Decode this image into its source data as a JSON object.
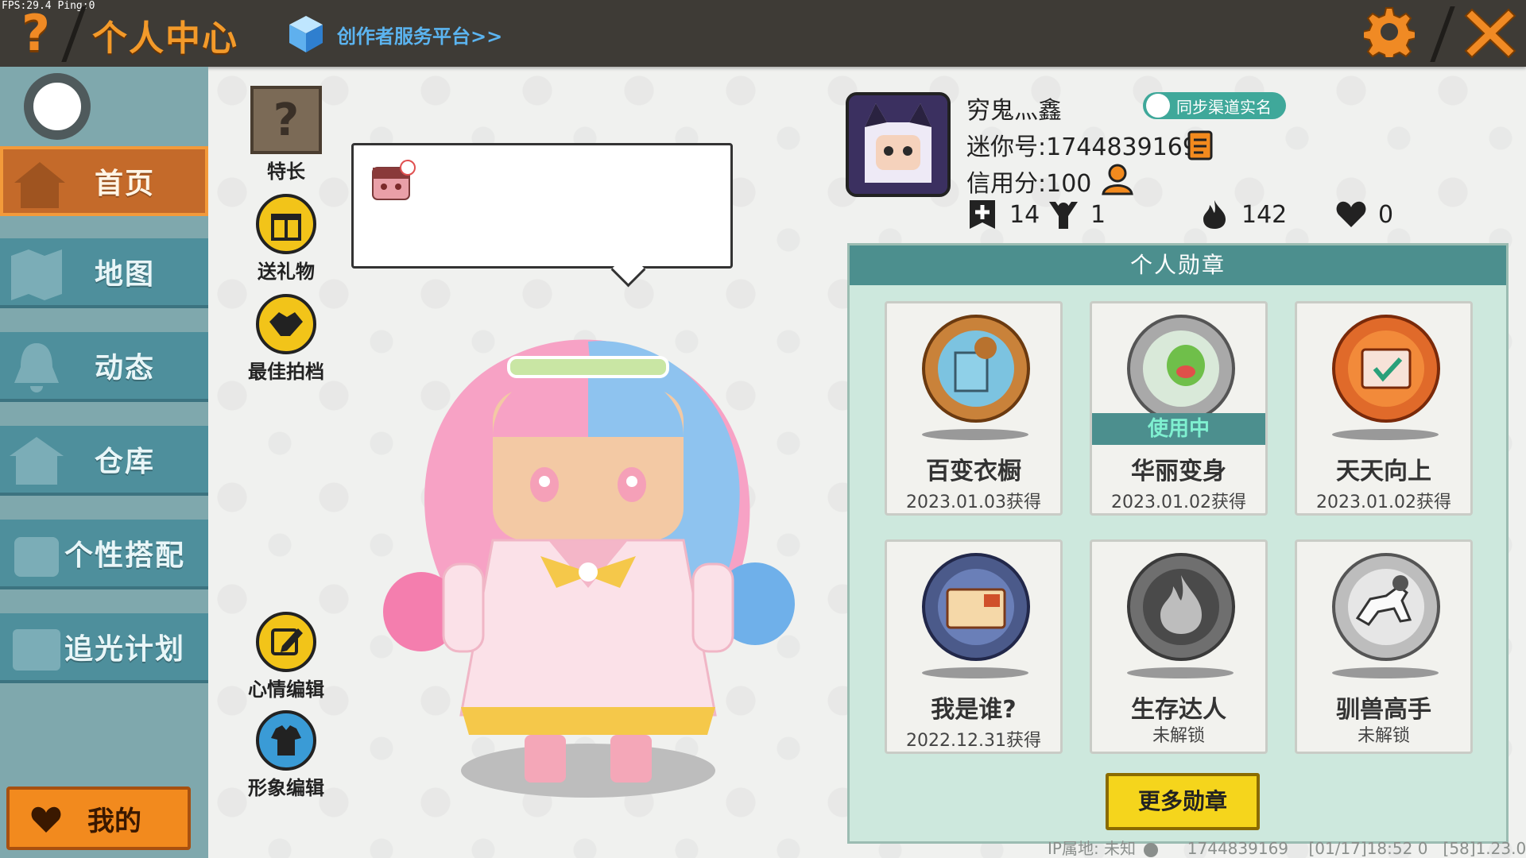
{
  "debug": {
    "fps_text": "FPS:29.4  Ping:0"
  },
  "header": {
    "title": "个人中心",
    "creator_link": "创作者服务平台>>",
    "colors": {
      "bar": "#3e3b36",
      "accent": "#f39a2a"
    }
  },
  "sidebar": {
    "items": [
      {
        "label": "首页",
        "icon": "house-icon",
        "active": true
      },
      {
        "label": "地图",
        "icon": "map-icon",
        "active": false
      },
      {
        "label": "动态",
        "icon": "bell-icon",
        "active": false
      },
      {
        "label": "仓库",
        "icon": "warehouse-icon",
        "active": false
      },
      {
        "label": "个性搭配",
        "icon": "outfit-icon",
        "active": false
      },
      {
        "label": "追光计划",
        "icon": "plan-icon",
        "active": false
      }
    ],
    "mine_label": "我的"
  },
  "actions": {
    "special": "特长",
    "gift": "送礼物",
    "best_photo": "最佳拍档",
    "mood_edit": "心情编辑",
    "image_edit": "形象编辑"
  },
  "profile": {
    "nickname": "穷鬼灬鑫",
    "mini_id": "迷你号:1744839169",
    "credit": "信用分:100",
    "sync_label": "同步渠道实名",
    "stats": {
      "plus": "14",
      "fans": "1",
      "fire": "142",
      "likes": "0"
    }
  },
  "medals": {
    "header": "个人勋章",
    "items": [
      {
        "name": "百变衣橱",
        "status": "2023.01.03获得",
        "unlocked": true,
        "in_use": false,
        "icon": "wardrobe-medal-icon"
      },
      {
        "name": "华丽变身",
        "status": "2023.01.02获得",
        "unlocked": true,
        "in_use": true,
        "in_use_label": "使用中",
        "icon": "transform-medal-icon"
      },
      {
        "name": "天天向上",
        "status": "2023.01.02获得",
        "unlocked": true,
        "in_use": false,
        "icon": "calendar-medal-icon"
      },
      {
        "name": "我是谁?",
        "status": "2022.12.31获得",
        "unlocked": true,
        "in_use": false,
        "icon": "idcard-medal-icon"
      },
      {
        "name": "生存达人",
        "status": "未解锁",
        "unlocked": false,
        "in_use": false,
        "icon": "fire-medal-icon"
      },
      {
        "name": "驯兽高手",
        "status": "未解锁",
        "unlocked": false,
        "in_use": false,
        "icon": "horse-medal-icon"
      }
    ],
    "more_label": "更多勋章"
  },
  "footer": {
    "ip_text": "IP属地: 未知",
    "uid_text": "1744839169",
    "time_text": "[01/17]18:52 0",
    "version_text": "[58]1.23.0"
  }
}
